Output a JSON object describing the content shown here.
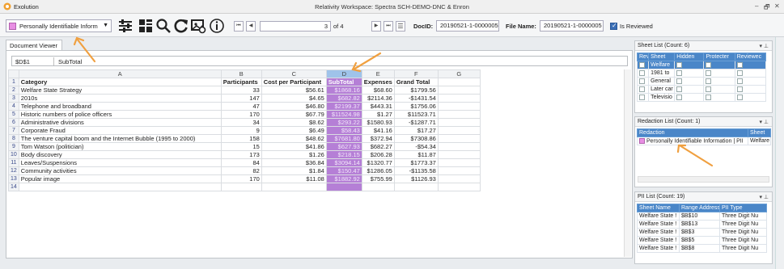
{
  "window": {
    "app_name": "Exolution",
    "title": "Relativity Workspace: Spectra SCH-DEMO-DNC & Enron",
    "controls": [
      "–",
      "🗗",
      "✕"
    ]
  },
  "toolbar": {
    "markup_set": "Personally Identifiable Inform",
    "page_current": "3",
    "page_of": "of 4",
    "docid_label": "DocID:",
    "docid_value": "20190521-1-0000005",
    "filename_label": "File Name:",
    "filename_value": "20190521-1-0000005",
    "reviewed_label": "Is Reviewed",
    "reviewed_checked": true
  },
  "viewer": {
    "tab_label": "Document Viewer",
    "cell_ref": "$D$1",
    "cell_value": "SubTotal"
  },
  "sheet": {
    "columns": [
      "A",
      "B",
      "C",
      "D",
      "E",
      "F",
      "G"
    ],
    "header": [
      "Category",
      "Participants",
      "Cost per Participant",
      "SubTotal",
      "Expenses",
      "Grand Total"
    ],
    "rows": [
      [
        "Welfare State Strategy",
        "33",
        "$56.61",
        "$1868.16",
        "$68.60",
        "$1799.56"
      ],
      [
        "2010s",
        "147",
        "$4.65",
        "$682.82",
        "$2114.36",
        "-$1431.54"
      ],
      [
        "Telephone and broadband",
        "47",
        "$46.80",
        "$2199.37",
        "$443.31",
        "$1756.06"
      ],
      [
        "Historic numbers of police officers",
        "170",
        "$67.79",
        "$11524.98",
        "$1.27",
        "$11523.71"
      ],
      [
        "Administrative divisions",
        "34",
        "$8.62",
        "$293.22",
        "$1580.93",
        "-$1287.71"
      ],
      [
        "Corporate Fraud",
        "9",
        "$6.49",
        "$58.43",
        "$41.16",
        "$17.27"
      ],
      [
        "The venture capital boom and the Internet Bubble (1995 to 2000)",
        "158",
        "$48.62",
        "$7681.80",
        "$372.94",
        "$7308.86"
      ],
      [
        "Tom Watson (politician)",
        "15",
        "$41.86",
        "$627.93",
        "$682.27",
        "-$54.34"
      ],
      [
        "Body discovery",
        "173",
        "$1.26",
        "$218.15",
        "$206.28",
        "$11.87"
      ],
      [
        "Leaves/Suspensions",
        "84",
        "$36.84",
        "$3094.14",
        "$1320.77",
        "$1773.37"
      ],
      [
        "Community activities",
        "82",
        "$1.84",
        "$150.47",
        "$1286.05",
        "-$1135.58"
      ],
      [
        "Popular image",
        "170",
        "$11.08",
        "$1882.92",
        "$755.99",
        "$1126.93"
      ]
    ]
  },
  "sheet_list": {
    "title": "Sheet List (Count: 6)",
    "columns": [
      "Revie",
      "Sheet",
      "Hidden",
      "Protecter",
      "Reviewec"
    ],
    "rows": [
      "Welfare",
      "1981 to",
      "General",
      "Later car",
      "Televisio"
    ]
  },
  "redaction_list": {
    "title": "Redaction List (Count: 1)",
    "columns": [
      "Redaction",
      "Sheet"
    ],
    "item": "Personally Identifiable Information | PII",
    "item_sheet": "Welfare"
  },
  "pii_list": {
    "title": "PII List (Count: 19)",
    "columns": [
      "Sheet Name",
      "Range Address",
      "PII Type"
    ],
    "rows": [
      [
        "Welfare State !",
        "$B$10",
        "Three Digit Nu"
      ],
      [
        "Welfare State !",
        "$B$13",
        "Three Digit Nu"
      ],
      [
        "Welfare State !",
        "$B$3",
        "Three Digit Nu"
      ],
      [
        "Welfare State !",
        "$B$5",
        "Three Digit Nu"
      ],
      [
        "Welfare State !",
        "$B$8",
        "Three Digit Nu"
      ]
    ]
  },
  "colors": {
    "accent": "#4a86c8",
    "highlight": "#b57fd6",
    "annotation_arrow": "#f0a040"
  }
}
